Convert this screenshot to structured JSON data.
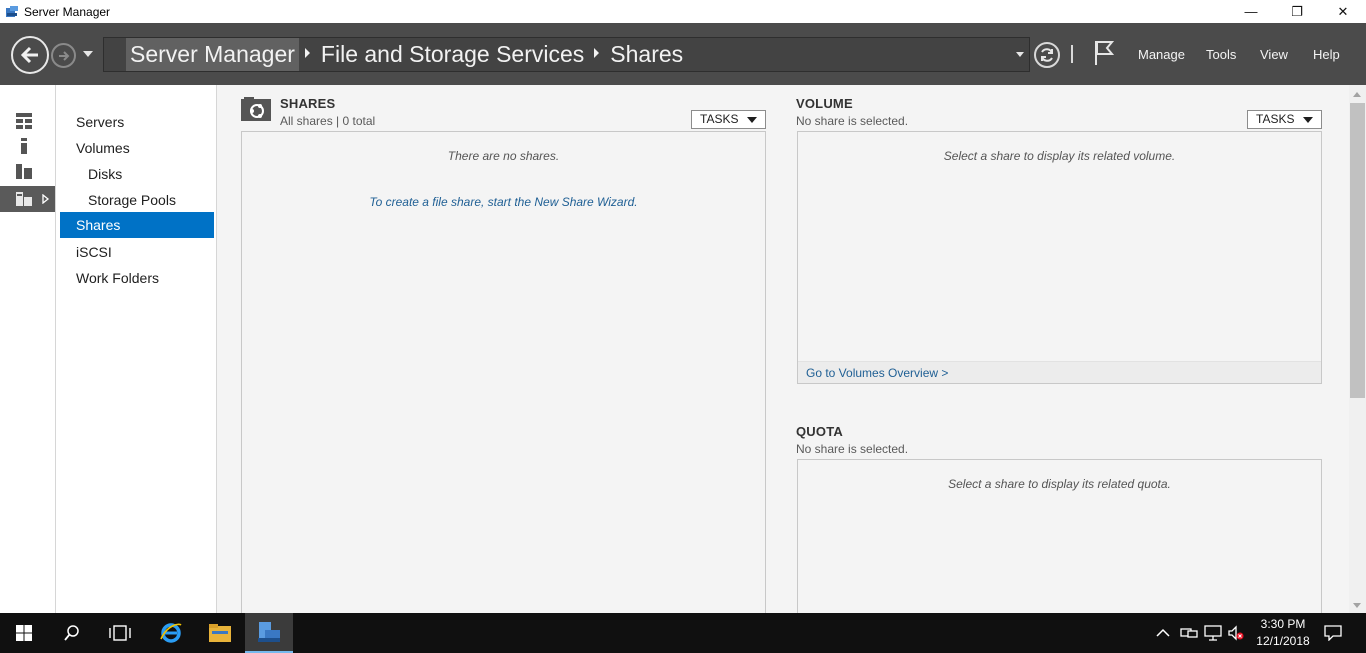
{
  "window": {
    "title": "Server Manager"
  },
  "window_controls": {
    "minimize": "—",
    "maximize": "❐",
    "close": "✕"
  },
  "breadcrumb": [
    "Server Manager",
    "File and Storage Services",
    "Shares"
  ],
  "menu": {
    "manage": "Manage",
    "tools": "Tools",
    "view": "View",
    "help": "Help"
  },
  "subnav": {
    "items": [
      {
        "label": "Servers",
        "child": false,
        "active": false
      },
      {
        "label": "Volumes",
        "child": false,
        "active": false
      },
      {
        "label": "Disks",
        "child": true,
        "active": false
      },
      {
        "label": "Storage Pools",
        "child": true,
        "active": false
      },
      {
        "label": "Shares",
        "child": false,
        "active": true
      },
      {
        "label": "iSCSI",
        "child": false,
        "active": false
      },
      {
        "label": "Work Folders",
        "child": false,
        "active": false
      }
    ]
  },
  "shares": {
    "title": "SHARES",
    "subtitle": "All shares | 0 total",
    "tasks": "TASKS",
    "empty": "There are no shares.",
    "create_link": "To create a file share, start the New Share Wizard."
  },
  "volume": {
    "title": "VOLUME",
    "subtitle": "No share is selected.",
    "tasks": "TASKS",
    "message": "Select a share to display its related volume.",
    "footer_link": "Go to Volumes Overview >"
  },
  "quota": {
    "title": "QUOTA",
    "subtitle": "No share is selected.",
    "message": "Select a share to display its related quota."
  },
  "taskbar": {
    "time": "3:30 PM",
    "date": "12/1/2018"
  },
  "colors": {
    "nav_bar": "#4b4b4b",
    "accent": "#0072c6",
    "taskbar": "#101010",
    "content_bg": "#f4f4f4",
    "link": "#1f5f94"
  }
}
